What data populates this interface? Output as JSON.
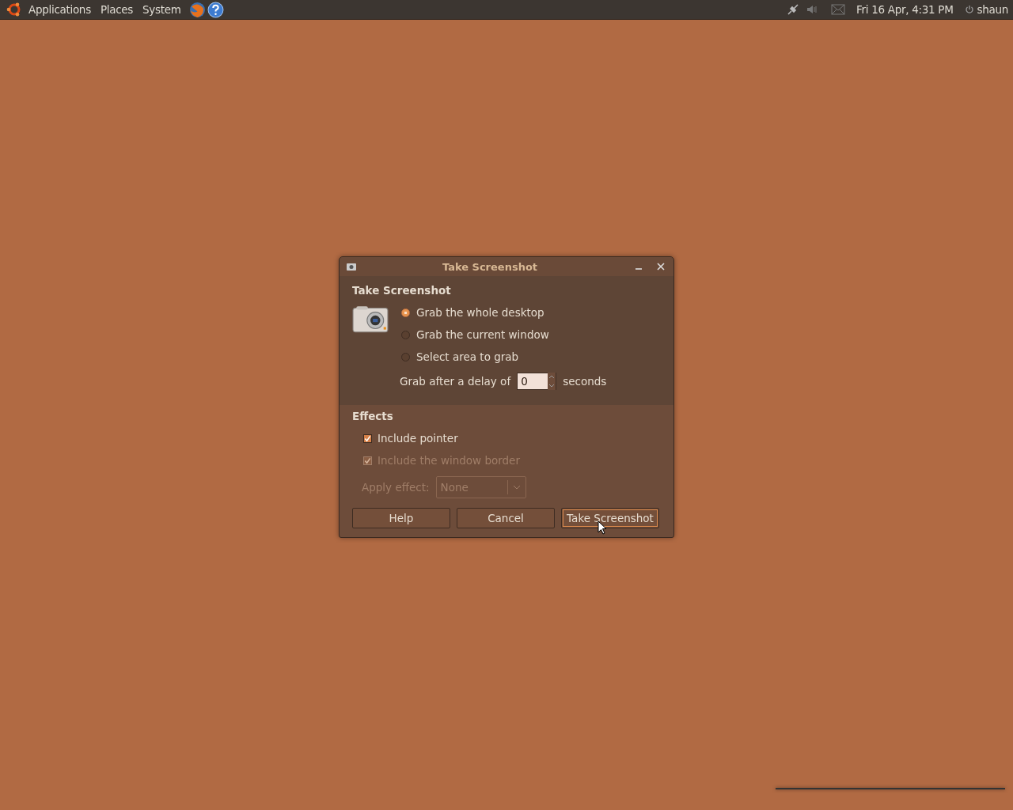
{
  "top_panel": {
    "menus": [
      "Applications",
      "Places",
      "System"
    ],
    "clock": "Fri 16 Apr,  4:31 PM",
    "user": "shaun"
  },
  "dialog": {
    "title": "Take Screenshot",
    "section": "Take Screenshot",
    "options": [
      {
        "label": "Grab the whole desktop",
        "selected": true
      },
      {
        "label": "Grab the current window",
        "selected": false
      },
      {
        "label": "Select area to grab",
        "selected": false
      }
    ],
    "delay": {
      "label": "Grab after a delay of",
      "value": "0",
      "unit": "seconds"
    },
    "effects_title": "Effects",
    "checks": [
      {
        "label": "Include pointer",
        "checked": true,
        "disabled": false
      },
      {
        "label": "Include the window border",
        "checked": true,
        "disabled": true
      }
    ],
    "apply_effect": {
      "label": "Apply effect:",
      "value": "None",
      "disabled": true
    },
    "buttons": [
      {
        "label": "Help",
        "focused": false
      },
      {
        "label": "Cancel",
        "focused": false
      },
      {
        "label": "Take Screenshot",
        "focused": true
      }
    ]
  }
}
